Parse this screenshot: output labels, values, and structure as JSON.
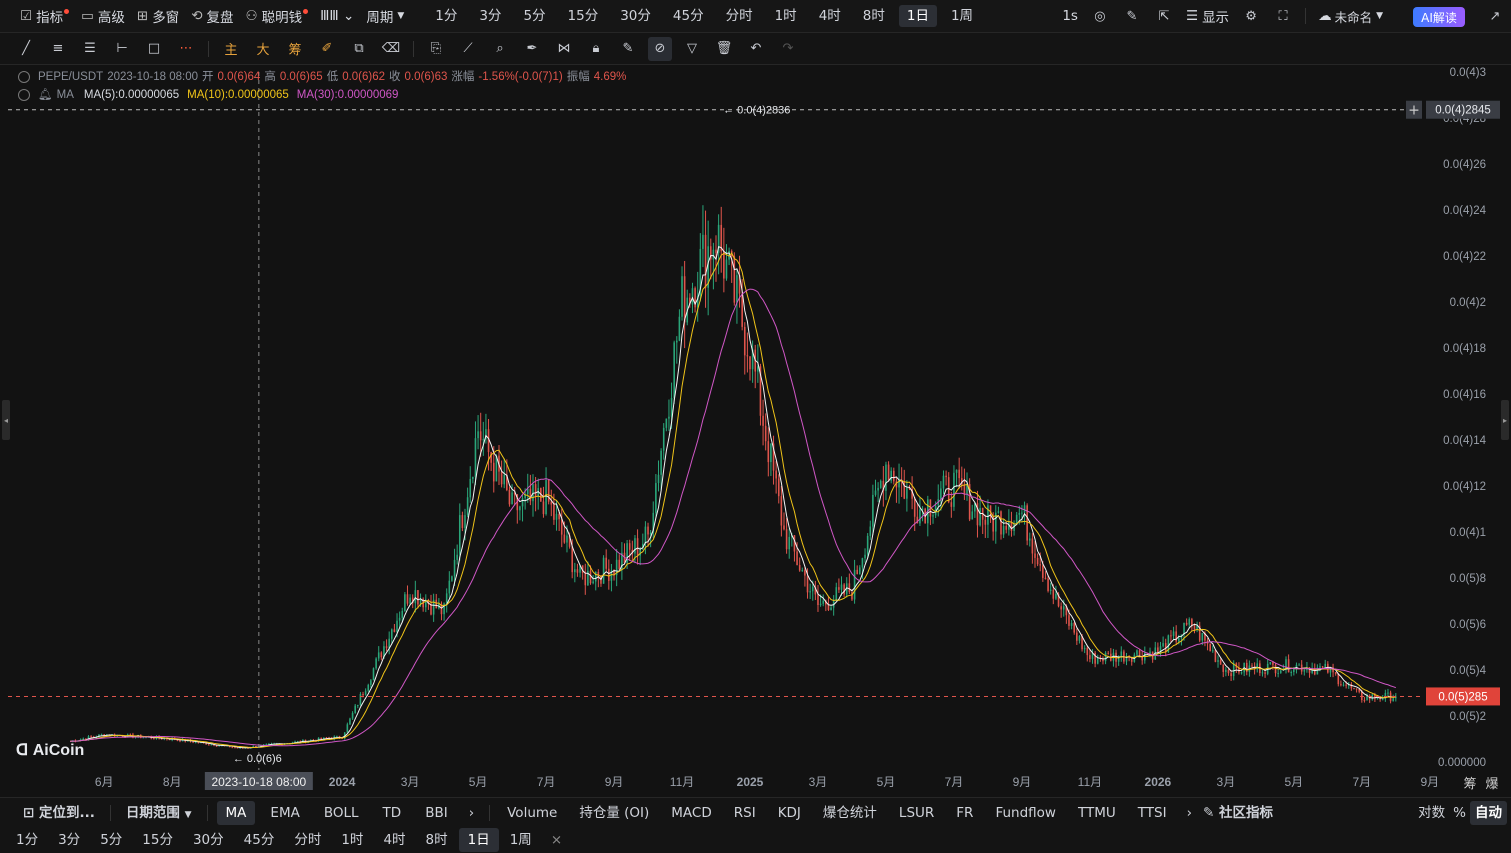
{
  "toolbar": {
    "left": [
      {
        "label": "指标",
        "icon": "indicator-icon",
        "dot": true
      },
      {
        "label": "高级",
        "icon": "advanced-icon",
        "dot": false
      },
      {
        "label": "多窗",
        "icon": "multi-window-icon",
        "dot": false
      },
      {
        "label": "复盘",
        "icon": "replay-icon",
        "dot": false
      },
      {
        "label": "聪明钱",
        "icon": "smart-money-icon",
        "dot": true
      }
    ],
    "period_label": "周期",
    "timeframes": [
      "1分",
      "3分",
      "5分",
      "15分",
      "30分",
      "45分",
      "分时",
      "1时",
      "4时",
      "8时",
      "1日",
      "1周"
    ],
    "active_timeframe": "1日",
    "realtime_label": "1s",
    "display_label": "显示",
    "layout_name": "未命名",
    "ai_label": "AI解读"
  },
  "drawing_tools": [
    "line-tool-icon",
    "parallel-lines-icon",
    "horizontal-lines-icon",
    "horizontal-ray-icon",
    "rectangle-icon",
    "dots-icon"
  ],
  "draw_text_tools": [
    "主",
    "大",
    "筹"
  ],
  "legend": {
    "symbol": "PEPE/USDT",
    "date": "2023-10-18 08:00",
    "open_label": "开",
    "open": "0.0(6)64",
    "high_label": "高",
    "high": "0.0(6)65",
    "low_label": "低",
    "low": "0.0(6)62",
    "close_label": "收",
    "close": "0.0(6)63",
    "change_label": "涨幅",
    "change": "-1.56%(-0.0(7)1)",
    "amp_label": "振幅",
    "amp": "4.69%",
    "ma_label": "MA",
    "ma5": "MA(5):0.00000065",
    "ma10": "MA(10):0.00000065",
    "ma30": "MA(30):0.00000069"
  },
  "price_axis": [
    "0.0(4)3",
    "0.0(4)28",
    "0.0(4)26",
    "0.0(4)24",
    "0.0(4)22",
    "0.0(4)2",
    "0.0(4)18",
    "0.0(4)16",
    "0.0(4)14",
    "0.0(4)12",
    "0.0(4)1",
    "0.0(5)8",
    "0.0(5)6",
    "0.0(5)4",
    "0.0(5)2",
    "0.000000"
  ],
  "crosshair_price": "0.0(4)2845",
  "current_price": "0.0(5)285",
  "high_marker": "0.0(4)2836",
  "low_marker": "0.0(6)6",
  "time_axis": [
    "6月",
    "8月",
    "2023-10-18 08:00",
    "2024",
    "3月",
    "5月",
    "7月",
    "9月",
    "11月",
    "2025",
    "3月",
    "5月",
    "7月",
    "9月",
    "11月",
    "2026",
    "3月",
    "5月",
    "7月",
    "9月"
  ],
  "axis_corner": [
    "筹",
    "爆"
  ],
  "logo": "AiCoin",
  "bottom_indicators": {
    "locate_label": "定位到...",
    "date_range_label": "日期范围",
    "main": [
      "MA",
      "EMA",
      "BOLL",
      "TD",
      "BBI"
    ],
    "active_main": "MA",
    "sub": [
      "Volume",
      "持仓量 (OI)",
      "MACD",
      "RSI",
      "KDJ",
      "爆仓统计",
      "LSUR",
      "FR",
      "Fundflow",
      "TTMU",
      "TTSI"
    ],
    "community_label": "社区指标",
    "log_label": "对数",
    "percent_label": "%",
    "auto_label": "自动"
  },
  "bottom_timeframes": [
    "1分",
    "3分",
    "5分",
    "15分",
    "30分",
    "45分",
    "分时",
    "1时",
    "4时",
    "8时",
    "1日",
    "1周"
  ],
  "bottom_active": "1日",
  "close_symbol": "×",
  "colors": {
    "up": "#2aa67a",
    "down": "#e0554c",
    "ma5": "#f5f5f5",
    "ma10": "#f0c419",
    "ma30": "#d057c6",
    "bg": "#121212"
  },
  "chart_data": {
    "type": "candlestick",
    "symbol": "PEPE/USDT",
    "interval": "1日",
    "x_start": "2023-05",
    "x_end": "2026-08",
    "y_unit": "USDT",
    "ylim": [
      0,
      3e-05
    ],
    "close_series": [
      {
        "t": "2023-05",
        "v": 9e-07
      },
      {
        "t": "2023-06",
        "v": 1.2e-06
      },
      {
        "t": "2023-08",
        "v": 1e-06
      },
      {
        "t": "2023-10",
        "v": 6e-07
      },
      {
        "t": "2024-01",
        "v": 1.1e-06
      },
      {
        "t": "2024-03",
        "v": 7.5e-06
      },
      {
        "t": "2024-04",
        "v": 6.5e-06
      },
      {
        "t": "2024-05",
        "v": 1.45e-05
      },
      {
        "t": "2024-06",
        "v": 1.1e-05
      },
      {
        "t": "2024-07",
        "v": 1.15e-05
      },
      {
        "t": "2024-08",
        "v": 8e-06
      },
      {
        "t": "2024-09",
        "v": 8.5e-06
      },
      {
        "t": "2024-10",
        "v": 9.8e-06
      },
      {
        "t": "2024-11",
        "v": 2e-05
      },
      {
        "t": "2024-12",
        "v": 2.3e-05
      },
      {
        "t": "2025-01",
        "v": 1.8e-05
      },
      {
        "t": "2025-02",
        "v": 1e-05
      },
      {
        "t": "2025-03",
        "v": 6.8e-06
      },
      {
        "t": "2025-04",
        "v": 7.5e-06
      },
      {
        "t": "2025-05",
        "v": 1.3e-05
      },
      {
        "t": "2025-06",
        "v": 1.1e-05
      },
      {
        "t": "2025-07",
        "v": 1.2e-05
      },
      {
        "t": "2025-08",
        "v": 1.05e-05
      },
      {
        "t": "2025-09",
        "v": 1.08e-05
      },
      {
        "t": "2025-10",
        "v": 7e-06
      },
      {
        "t": "2025-11",
        "v": 4.5e-06
      },
      {
        "t": "2026-01",
        "v": 4.8e-06
      },
      {
        "t": "2026-02",
        "v": 6e-06
      },
      {
        "t": "2026-03",
        "v": 4e-06
      },
      {
        "t": "2026-05",
        "v": 4.2e-06
      },
      {
        "t": "2026-06",
        "v": 4e-06
      },
      {
        "t": "2026-07",
        "v": 2.8e-06
      },
      {
        "t": "2026-08",
        "v": 2.85e-06
      }
    ],
    "high": 2.836e-05,
    "low": 6e-07,
    "last": 2.85e-06
  }
}
